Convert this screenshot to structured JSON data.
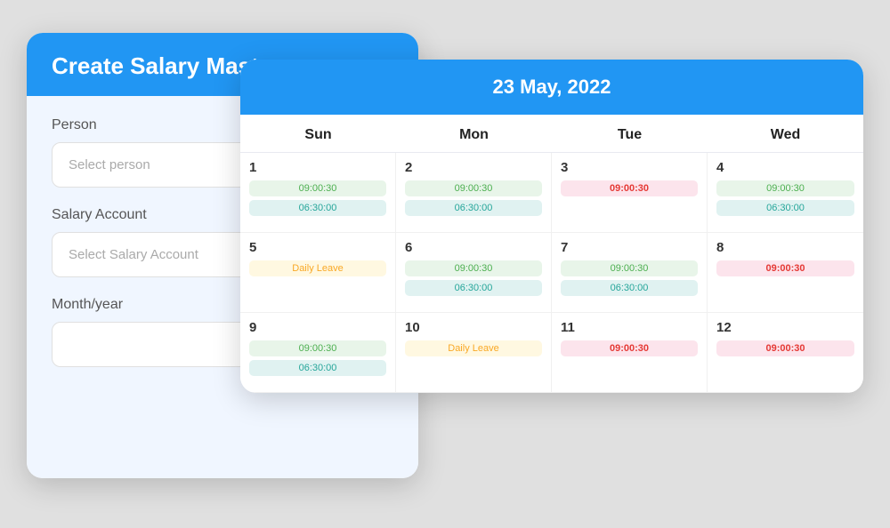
{
  "leftCard": {
    "title": "Create Salary Master",
    "personLabel": "Person",
    "personPlaceholder": "Select person",
    "salaryAccountLabel": "Salary Account",
    "salaryAccountPlaceholder": "Select Salary Account",
    "monthYearLabel": "Month/year"
  },
  "calendar": {
    "title": "23 May, 2022",
    "dayHeaders": [
      "Sun",
      "Mon",
      "Tue",
      "Wed"
    ],
    "rows": [
      [
        {
          "date": "1",
          "badges": [
            {
              "text": "09:00:30",
              "type": "green"
            },
            {
              "text": "06:30:00",
              "type": "teal"
            }
          ]
        },
        {
          "date": "2",
          "badges": [
            {
              "text": "09:00:30",
              "type": "green"
            },
            {
              "text": "06:30:00",
              "type": "teal"
            }
          ]
        },
        {
          "date": "3",
          "badges": [
            {
              "text": "09:00:30",
              "type": "red"
            }
          ]
        },
        {
          "date": "4",
          "badges": [
            {
              "text": "09:00:30",
              "type": "green"
            },
            {
              "text": "06:30:00",
              "type": "teal"
            }
          ]
        }
      ],
      [
        {
          "date": "5",
          "badges": [
            {
              "text": "Daily Leave",
              "type": "yellow"
            }
          ]
        },
        {
          "date": "6",
          "badges": [
            {
              "text": "09:00:30",
              "type": "green"
            },
            {
              "text": "06:30:00",
              "type": "teal"
            }
          ]
        },
        {
          "date": "7",
          "badges": [
            {
              "text": "09:00:30",
              "type": "green"
            },
            {
              "text": "06:30:00",
              "type": "teal"
            }
          ]
        },
        {
          "date": "8",
          "badges": [
            {
              "text": "09:00:30",
              "type": "red"
            }
          ]
        }
      ],
      [
        {
          "date": "9",
          "badges": [
            {
              "text": "09:00:30",
              "type": "green"
            },
            {
              "text": "06:30:00",
              "type": "teal"
            }
          ]
        },
        {
          "date": "10",
          "badges": [
            {
              "text": "Daily Leave",
              "type": "yellow"
            }
          ]
        },
        {
          "date": "11",
          "badges": [
            {
              "text": "09:00:30",
              "type": "red"
            }
          ]
        },
        {
          "date": "12",
          "badges": [
            {
              "text": "09:00:30",
              "type": "red"
            }
          ]
        }
      ]
    ]
  }
}
